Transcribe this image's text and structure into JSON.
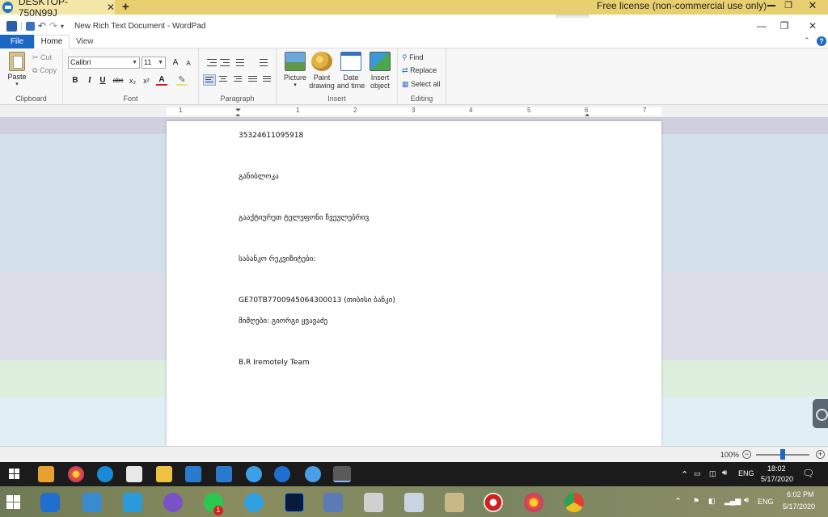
{
  "teamviewer": {
    "tab_title": "DESKTOP-750N99J",
    "close_glyph": "✕",
    "add_glyph": "+",
    "license_text": "Free license (non-commercial use only)"
  },
  "window": {
    "title": "New Rich Text Document - WordPad",
    "minimize": "—",
    "maximize": "❐",
    "close": "✕"
  },
  "ribbon_tabs": {
    "file": "File",
    "home": "Home",
    "view": "View"
  },
  "clipboard": {
    "paste": "Paste",
    "cut": "Cut",
    "copy": "Copy",
    "label": "Clipboard"
  },
  "font": {
    "name": "Calibri",
    "size": "11",
    "grow": "A",
    "shrink": "A",
    "bold": "B",
    "italic": "I",
    "underline": "U",
    "strike": "abc",
    "subscript": "x₂",
    "superscript": "x²",
    "color": "A",
    "label": "Font"
  },
  "paragraph": {
    "label": "Paragraph"
  },
  "insert": {
    "picture": "Picture",
    "paint": "Paint drawing",
    "datetime": "Date and time",
    "object": "Insert object",
    "label": "Insert"
  },
  "editing": {
    "find": "Find",
    "replace": "Replace",
    "select_all": "Select all",
    "label": "Editing"
  },
  "ruler": {
    "numbers": [
      "1",
      "1",
      "2",
      "3",
      "4",
      "5",
      "6",
      "7"
    ]
  },
  "document": {
    "lines": [
      "35324611095918",
      "განიბლოკა",
      "გააქტიურეთ ტელეფონი ჩვეულებრივ",
      "საბანკო რეკვიზიტები:",
      "GE70TB7700945064300013 (თიბისი ბანკი)",
      "მიმღები: გიორგი ყვავაძე",
      "B.R Iremotely Team"
    ]
  },
  "status": {
    "zoom": "100%",
    "zoom_minus": "−",
    "zoom_plus": "+"
  },
  "remote_taskbar": {
    "lang": "ENG",
    "time": "18:02",
    "date": "5/17/2020"
  },
  "local_taskbar": {
    "lang": "ENG",
    "time": "6:02 PM",
    "date": "5/17/2020",
    "badge": "1"
  },
  "colors": {
    "accent": "#1a67c4",
    "tv_bar": "#e8d070",
    "taskbar_remote": "#1b1b1b"
  }
}
